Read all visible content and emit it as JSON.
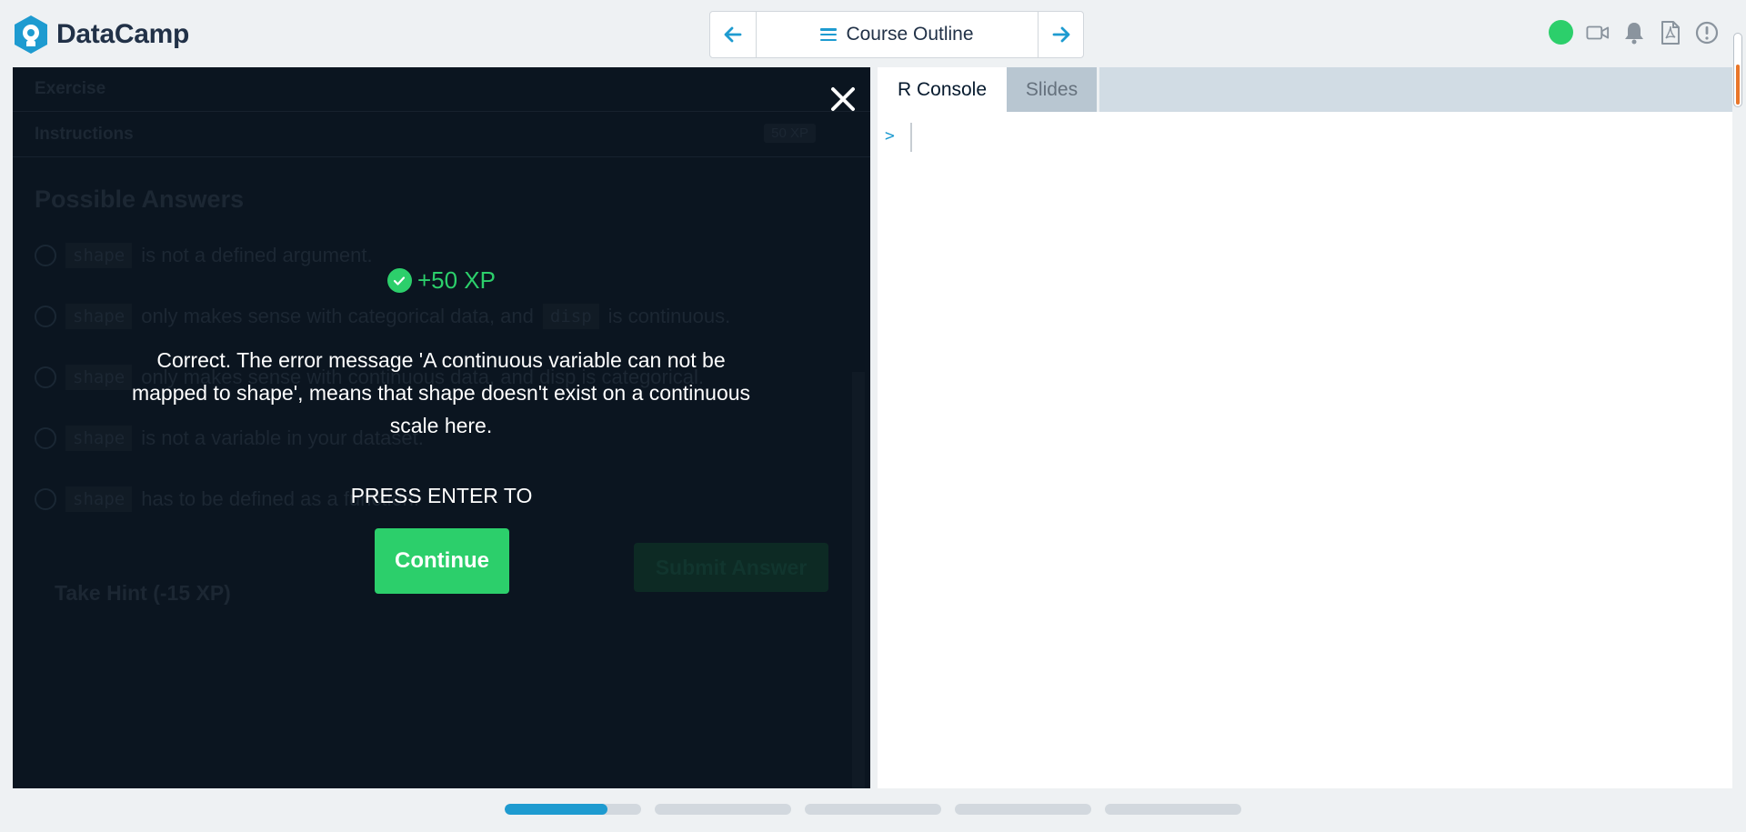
{
  "header": {
    "brand": "DataCamp",
    "outline_label": "Course Outline",
    "prev_label": "←",
    "next_label": "→"
  },
  "exercise_background": {
    "exercise_label": "Exercise",
    "instructions_label": "Instructions",
    "xp_badge": "50 XP",
    "possible_answers_title": "Possible Answers",
    "answers": [
      {
        "code": "shape",
        "text": "is not a defined argument."
      },
      {
        "code": "shape",
        "text": "only makes sense with categorical data, and",
        "code2": "disp",
        "text2": "is continuous."
      },
      {
        "code": "shape",
        "text": "only makes sense with continuous data, and disp is categorical."
      },
      {
        "code": "shape",
        "text": "is not a variable in your dataset."
      },
      {
        "code": "shape",
        "text": "has to be defined as a function."
      }
    ],
    "submit_label": "Submit Answer",
    "hint_label": "Take Hint (-15 XP)"
  },
  "modal": {
    "xp_gain": "+50 XP",
    "feedback": "Correct. The error message 'A continuous variable can not be mapped to shape', means that shape doesn't exist on a continuous scale here.",
    "press_enter": "PRESS ENTER TO",
    "continue_label": "Continue",
    "close_label": "×"
  },
  "right_panel": {
    "tabs": [
      {
        "label": "R Console",
        "active": true
      },
      {
        "label": "Slides",
        "active": false
      }
    ],
    "prompt": ">"
  },
  "progress": {
    "segments": [
      0.75,
      0,
      0,
      0,
      0
    ]
  },
  "colors": {
    "accent_blue": "#1e9bd0",
    "success_green": "#2ccf6b",
    "dark_panel": "#0b1520"
  }
}
